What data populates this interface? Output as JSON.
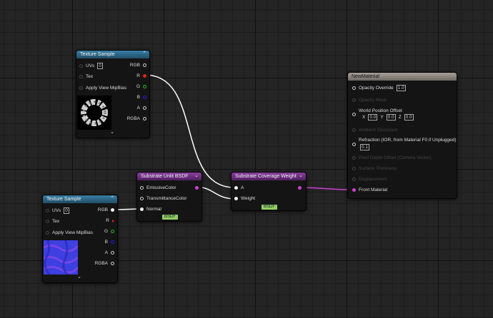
{
  "nodes": {
    "tex1": {
      "title": "Texture Sample",
      "uvs_label": "UVs",
      "uvs_value": "0",
      "tex_label": "Tex",
      "mip_label": "Apply View MipBias",
      "outputs": [
        "RGB",
        "R",
        "G",
        "B",
        "A",
        "RGBA"
      ]
    },
    "tex2": {
      "title": "Texture Sample",
      "uvs_label": "UVs",
      "uvs_value": "0",
      "tex_label": "Tex",
      "mip_label": "Apply View MipBias",
      "outputs": [
        "RGB",
        "R",
        "G",
        "B",
        "A",
        "RGBA"
      ]
    },
    "unlit": {
      "title": "Substrate Unlit BSDF",
      "inputs": [
        "EmissiveColor",
        "TransmittanceColor",
        "Normal"
      ],
      "badge": "BSDF"
    },
    "coverage": {
      "title": "Substrate Coverage Weight",
      "inputs": [
        "A",
        "Weight"
      ],
      "badge": "BSDF"
    },
    "material": {
      "title": "NewMaterial",
      "opacity_override": "Opacity Override",
      "opacity_override_value": "1.0",
      "opacity_mask": "Opacity Mask",
      "wpo": "World Position Offset",
      "wpo_x_label": "X",
      "wpo_x": "0.0",
      "wpo_y_label": "Y",
      "wpo_y": "0.0",
      "wpo_z_label": "Z",
      "wpo_z": "0.0",
      "ambient_occlusion": "Ambient Occlusion",
      "refraction": "Refraction (IOR, from Material F0 if Unplugged)",
      "refraction_value": "0.1",
      "pixel_depth_offset": "Pixel Depth Offset (Camera Vector)",
      "surface_thickness": "Surface Thickness",
      "displacement": "Displacement",
      "front_material": "Front Material"
    }
  },
  "colors": {
    "texture_header": "#2f6f93",
    "substrate_header": "#7a3590",
    "material_header": "#9a948e",
    "wire_white": "#ffffff",
    "wire_magenta": "#d040d0",
    "badge": "#8fd060"
  }
}
